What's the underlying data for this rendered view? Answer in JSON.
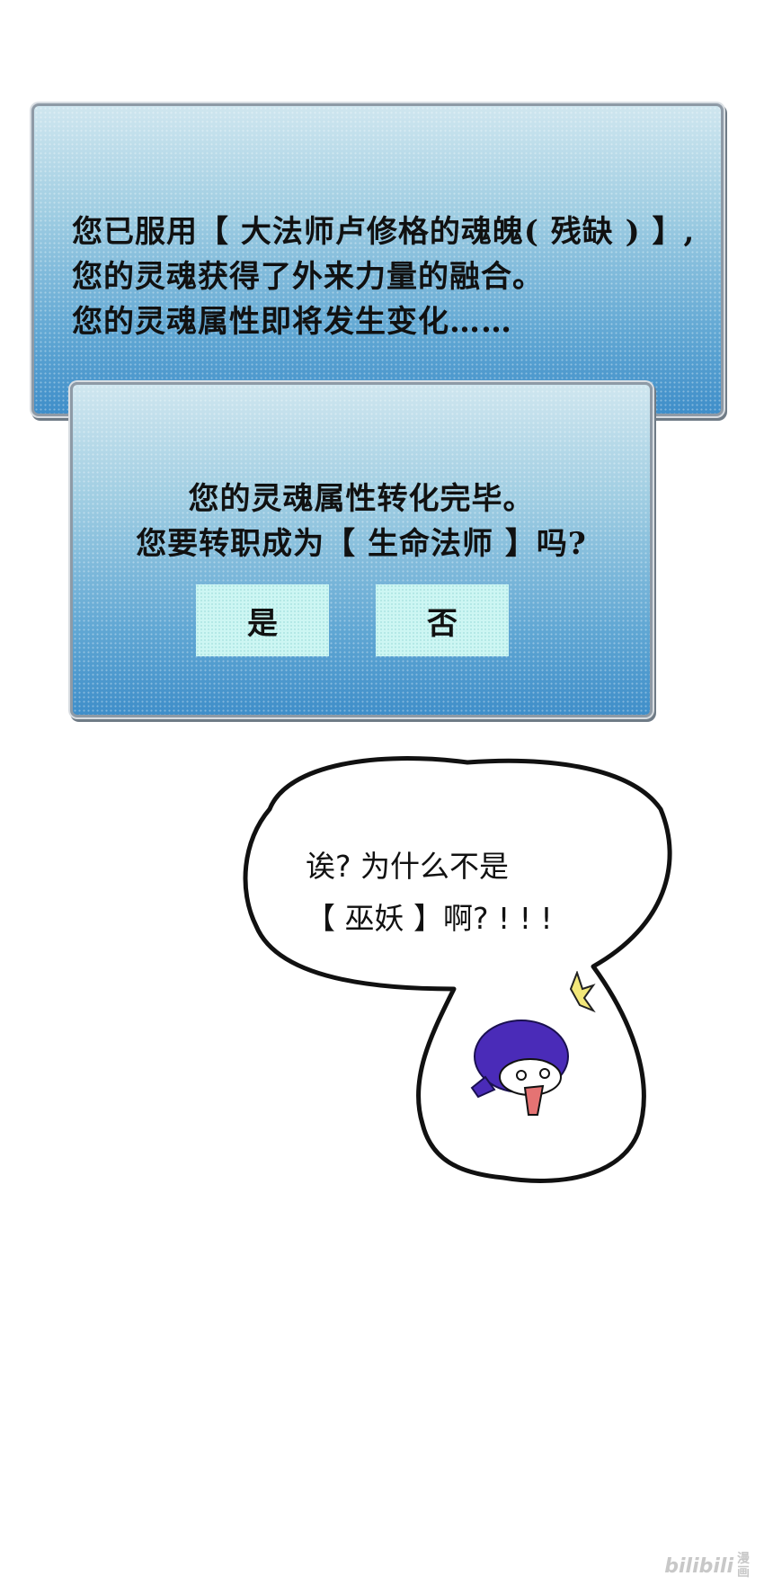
{
  "system_notice": {
    "lines": [
      "您已服用【 大法师卢修格的魂魄( 残缺 ) 】,",
      "您的灵魂获得了外来力量的融合。",
      "您的灵魂属性即将发生变化……"
    ]
  },
  "job_dialog": {
    "lines": [
      "您的灵魂属性转化完毕。",
      "您要转职成为【 生命法师 】吗?"
    ],
    "yes_label": "是",
    "no_label": "否"
  },
  "speech_bubble": {
    "lines": [
      "诶? 为什么不是",
      "【 巫妖 】啊? ! ! !"
    ]
  },
  "watermark": {
    "brand": "bilibili",
    "sub": "漫画"
  },
  "colors": {
    "panel_top": "#cfe6ef",
    "panel_bottom": "#3f8ec9",
    "button_bg": "#cdf6f3",
    "chibi_hair": "#4a2bb8"
  }
}
